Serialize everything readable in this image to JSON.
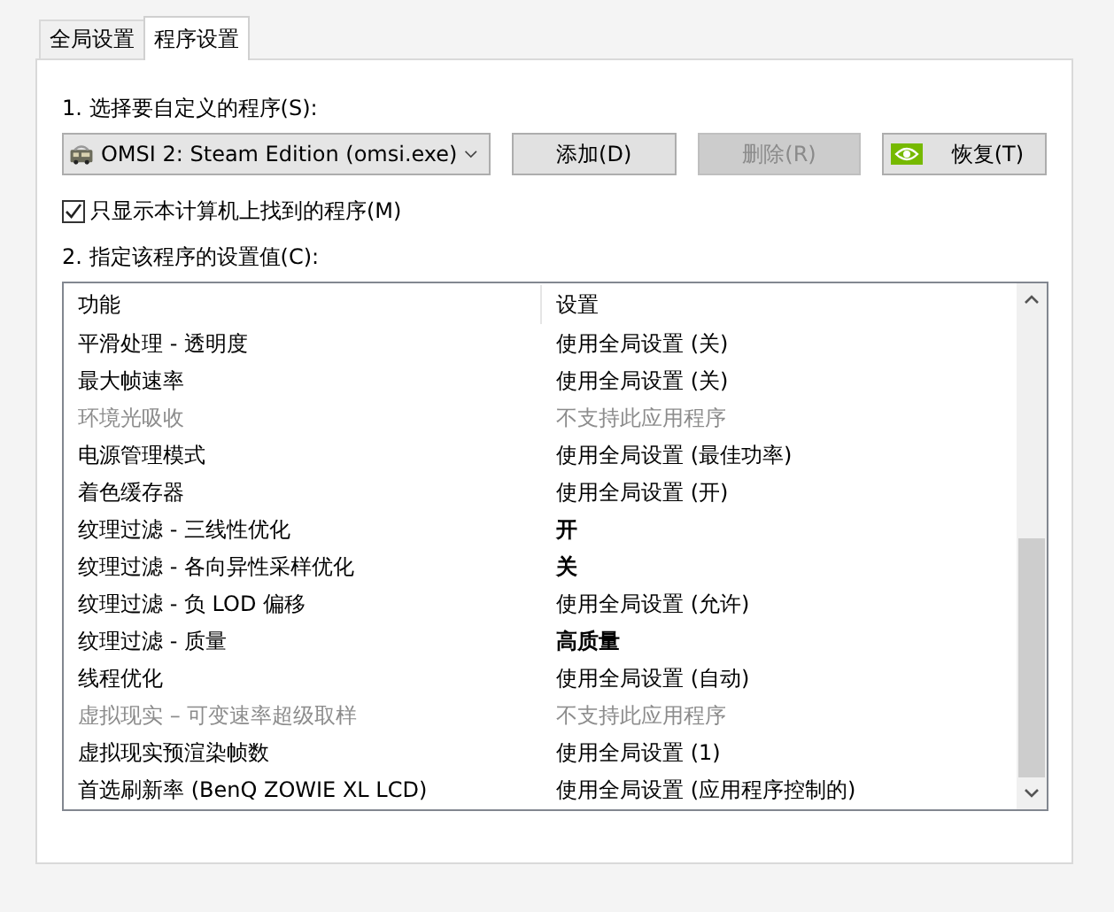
{
  "tabs": [
    {
      "label": "全局设置",
      "selected": false
    },
    {
      "label": "程序设置",
      "selected": true
    }
  ],
  "step1_label": "1. 选择要自定义的程序(S):",
  "program_select": {
    "value": "OMSI 2: Steam Edition (omsi.exe)"
  },
  "buttons": [
    {
      "label": "添加(D)",
      "disabled": false,
      "kind": "plain"
    },
    {
      "label": "删除(R)",
      "disabled": true,
      "kind": "plain"
    },
    {
      "label": "恢复(T)",
      "disabled": false,
      "kind": "logo"
    }
  ],
  "only_found_checkbox": {
    "label": "只显示本计算机上找到的程序(M)",
    "checked": true
  },
  "step2_label": "2. 指定该程序的设置值(C):",
  "table": {
    "columns": [
      "功能",
      "设置"
    ],
    "rows": [
      {
        "feature": "平滑处理 - 透明度",
        "setting": "使用全局设置 (关)",
        "disabled": false,
        "overridden": false
      },
      {
        "feature": "最大帧速率",
        "setting": "使用全局设置 (关)",
        "disabled": false,
        "overridden": false
      },
      {
        "feature": "环境光吸收",
        "setting": "不支持此应用程序",
        "disabled": true,
        "overridden": false
      },
      {
        "feature": "电源管理模式",
        "setting": "使用全局设置 (最佳功率)",
        "disabled": false,
        "overridden": false
      },
      {
        "feature": "着色缓存器",
        "setting": "使用全局设置 (开)",
        "disabled": false,
        "overridden": false
      },
      {
        "feature": "纹理过滤 - 三线性优化",
        "setting": "开",
        "disabled": false,
        "overridden": true
      },
      {
        "feature": "纹理过滤 - 各向异性采样优化",
        "setting": "关",
        "disabled": false,
        "overridden": true
      },
      {
        "feature": "纹理过滤 - 负 LOD 偏移",
        "setting": "使用全局设置 (允许)",
        "disabled": false,
        "overridden": false
      },
      {
        "feature": "纹理过滤 - 质量",
        "setting": "高质量",
        "disabled": false,
        "overridden": true
      },
      {
        "feature": "线程优化",
        "setting": "使用全局设置 (自动)",
        "disabled": false,
        "overridden": false
      },
      {
        "feature": "虚拟现实 – 可变速率超级取样",
        "setting": "不支持此应用程序",
        "disabled": true,
        "overridden": false
      },
      {
        "feature": "虚拟现实预渲染帧数",
        "setting": "使用全局设置 (1)",
        "disabled": false,
        "overridden": false
      },
      {
        "feature": "首选刷新率 (BenQ ZOWIE XL LCD)",
        "setting": "使用全局设置 (应用程序控制的)",
        "disabled": false,
        "overridden": false
      }
    ]
  }
}
